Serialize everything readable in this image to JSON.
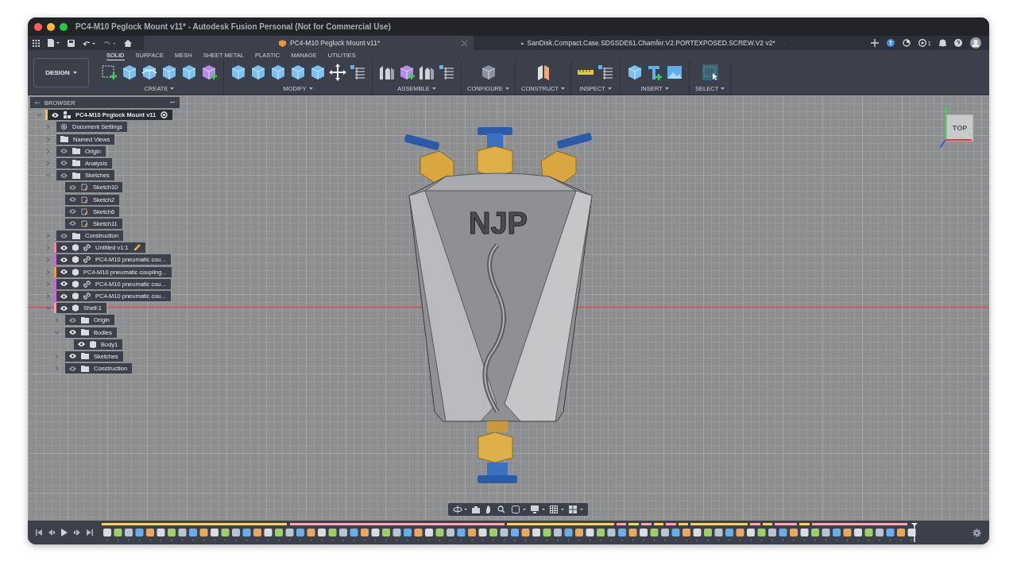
{
  "window": {
    "title": "PC4-M10 Peglock Mount v11* - Autodesk Fusion Personal (Not for Commercial Use)"
  },
  "document_tabs": [
    {
      "label": "PC4-M10 Peglock Mount v11*",
      "selected": true,
      "locked": false
    },
    {
      "label": "SanDisk.Compact.Case.SDSSDE61.Chamfer.V2.PORTEXPOSED.SCREW.V2 v2*",
      "selected": false,
      "locked": true
    }
  ],
  "job_count": "1",
  "workspace": "DESIGN",
  "toolbar_tabs": [
    {
      "label": "SOLID",
      "selected": true
    },
    {
      "label": "SURFACE",
      "selected": false
    },
    {
      "label": "MESH",
      "selected": false
    },
    {
      "label": "SHEET METAL",
      "selected": false
    },
    {
      "label": "PLASTIC",
      "selected": false
    },
    {
      "label": "MANAGE",
      "selected": false
    },
    {
      "label": "UTILITIES",
      "selected": false
    }
  ],
  "toolbar_groups": [
    "CREATE",
    "MODIFY",
    "ASSEMBLE",
    "CONFIGURE",
    "CONSTRUCT",
    "INSPECT",
    "INSERT",
    "SELECT"
  ],
  "browser": {
    "title": "BROWSER",
    "root": {
      "label": "PC4-M10 Peglock Mount v11",
      "kind": "root",
      "visible": true,
      "expanded": true,
      "color": "#e8c84a",
      "children": [
        {
          "label": "Document Settings",
          "kind": "settings",
          "expanded": false
        },
        {
          "label": "Named Views",
          "kind": "folder",
          "expanded": false
        },
        {
          "label": "Origin",
          "kind": "folder",
          "visible": false,
          "expanded": false
        },
        {
          "label": "Analysis",
          "kind": "folder",
          "visible": false,
          "expanded": false
        },
        {
          "label": "Sketches",
          "kind": "folder",
          "visible": false,
          "expanded": true,
          "children": [
            {
              "label": "Sketch10",
              "kind": "sketch",
              "visible": false
            },
            {
              "label": "Sketch2",
              "kind": "sketch",
              "visible": false
            },
            {
              "label": "Sketch6",
              "kind": "sketch",
              "visible": false
            },
            {
              "label": "Sketch11",
              "kind": "sketch",
              "visible": false
            }
          ]
        },
        {
          "label": "Construction",
          "kind": "folder",
          "visible": false,
          "expanded": false
        },
        {
          "label": "Untitled v1:1",
          "kind": "component",
          "visible": true,
          "expanded": false,
          "linked": true,
          "editing": true,
          "color": "#e88aa8"
        },
        {
          "label": "PC4-M10 pneumatic cou...",
          "kind": "component",
          "visible": true,
          "expanded": false,
          "linked": true,
          "editing": false,
          "color": "#c86ad8"
        },
        {
          "label": "PC4-M10 pneumatic coupling...",
          "kind": "component",
          "visible": true,
          "expanded": false,
          "linked": false,
          "editing": false,
          "color": "#f09a50"
        },
        {
          "label": "PC4-M10 pneumatic cou...",
          "kind": "component",
          "visible": true,
          "expanded": false,
          "linked": true,
          "editing": false,
          "color": "#c86ad8"
        },
        {
          "label": "PC4-M10 pneumatic cou...",
          "kind": "component",
          "visible": true,
          "expanded": false,
          "linked": true,
          "editing": false,
          "color": "#c86ad8"
        },
        {
          "label": "Shell:1",
          "kind": "component",
          "visible": true,
          "expanded": true,
          "linked": false,
          "editing": false,
          "color": "#f0a0b0",
          "children": [
            {
              "label": "Origin",
              "kind": "folder",
              "visible": false,
              "expanded": false
            },
            {
              "label": "Bodies",
              "kind": "folder",
              "visible": true,
              "expanded": true,
              "children": [
                {
                  "label": "Body1",
                  "kind": "body",
                  "visible": true
                }
              ]
            },
            {
              "label": "Sketches",
              "kind": "folder",
              "visible": true,
              "expanded": false
            },
            {
              "label": "Construction",
              "kind": "folder",
              "visible": false,
              "expanded": false
            }
          ]
        }
      ]
    }
  },
  "model_label": "NJP",
  "viewcube": "TOP"
}
